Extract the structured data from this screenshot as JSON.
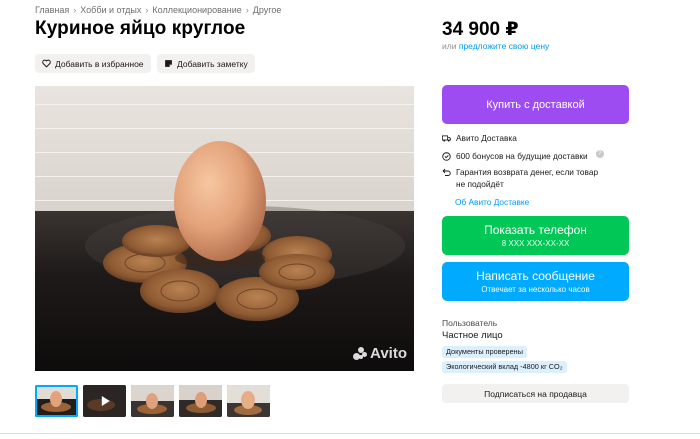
{
  "breadcrumb": [
    "Главная",
    "Хобби и отдых",
    "Коллекционирование",
    "Другое"
  ],
  "breadcrumb_separator": "›",
  "title": "Куриное яйцо круглое",
  "actions": {
    "favorite": "Добавить в избранное",
    "note": "Добавить заметку"
  },
  "gallery": {
    "watermark": "Avito",
    "thumbnails": [
      "photo-1",
      "video",
      "photo-3",
      "photo-4",
      "photo-5"
    ],
    "active_index": 0
  },
  "price": {
    "value": "34 900 ₽",
    "offer_prefix": "или",
    "offer_link": "предложите свою цену"
  },
  "buttons": {
    "buy_delivery": "Купить с доставкой",
    "show_phone": "Показать телефон",
    "phone_masked": "8 XXX XXX-XX-XX",
    "write_message": "Написать сообщение",
    "reply_time": "Отвечает за несколько часов",
    "subscribe": "Подписаться на продавца"
  },
  "delivery": {
    "service": "Авито Доставка",
    "bonus": "600 бонусов на будущие доставки",
    "guarantee_line1": "Гарантия возврата денег, если товар",
    "guarantee_line2": "не подойдёт",
    "about_link": "Об Авито Доставке"
  },
  "seller": {
    "role": "Пользователь",
    "type": "Частное лицо",
    "badges": [
      "Документы проверены",
      "Экологический вклад -4800 кг CO₂"
    ]
  },
  "colors": {
    "buy": "#9d4cf2",
    "phone": "#00c755",
    "message": "#00aaff",
    "link": "#0099f7"
  }
}
